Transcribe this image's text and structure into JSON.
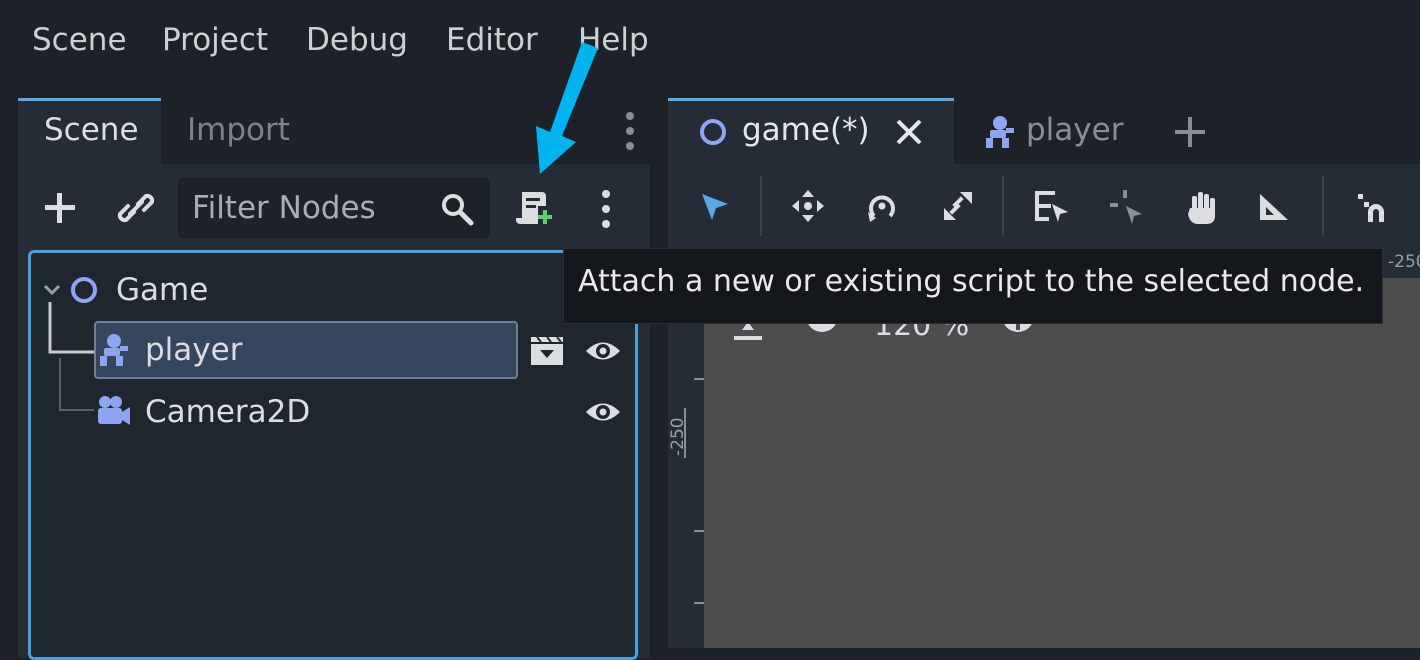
{
  "menu": {
    "scene": "Scene",
    "project": "Project",
    "debug": "Debug",
    "editor": "Editor",
    "help": "Help"
  },
  "scene_dock": {
    "tabs": [
      {
        "label": "Scene",
        "active": true
      },
      {
        "label": "Import",
        "active": false
      }
    ],
    "filter_placeholder": "Filter Nodes",
    "tree": [
      {
        "label": "Game",
        "icon": "node-circle-icon"
      },
      {
        "label": "player",
        "icon": "character-body-icon",
        "selected": true
      },
      {
        "label": "Camera2D",
        "icon": "camera-icon"
      }
    ]
  },
  "editor": {
    "tabs": [
      {
        "label": "game(*)",
        "icon": "node-circle-icon",
        "active": true
      },
      {
        "label": "player",
        "icon": "character-body-icon",
        "active": false
      }
    ],
    "zoom": "120 %",
    "ruler_top_label": "-250",
    "ruler_left_label": "-250"
  },
  "tooltip": {
    "text": "Attach a new or existing script to the selected node."
  },
  "colors": {
    "accent": "#5aa9e6",
    "annotation_arrow": "#00b4f0",
    "node_icon": "#8da5f3",
    "script_add": "#5fd16a"
  }
}
